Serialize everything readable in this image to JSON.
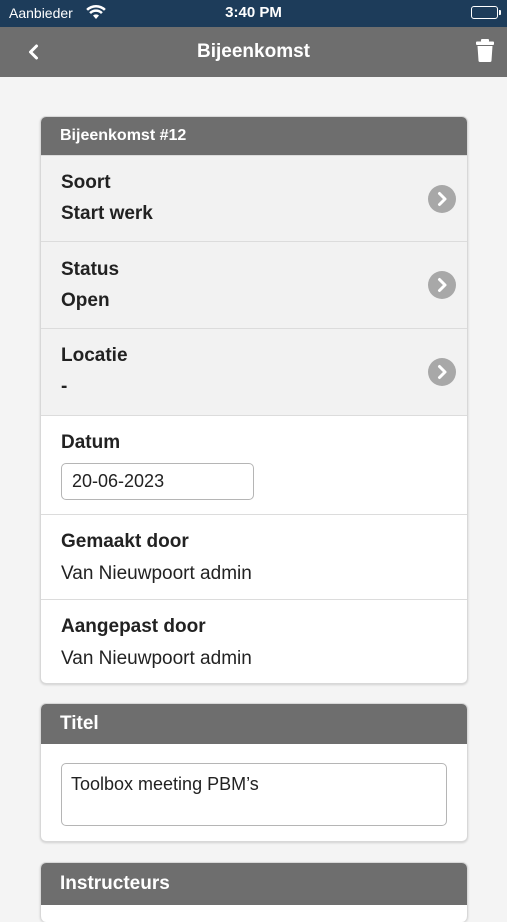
{
  "status_bar": {
    "carrier": "Aanbieder",
    "time": "3:40 PM"
  },
  "nav": {
    "title": "Bijeenkomst",
    "back_icon": "chevron-left-icon",
    "delete_icon": "trash-icon"
  },
  "meeting_card": {
    "header": "Bijeenkomst #12",
    "soort": {
      "label": "Soort",
      "value": "Start werk"
    },
    "status": {
      "label": "Status",
      "value": "Open"
    },
    "locatie": {
      "label": "Locatie",
      "value": "-"
    },
    "datum": {
      "label": "Datum",
      "value": "20-06-2023"
    },
    "gemaakt_door": {
      "label": "Gemaakt door",
      "value": "Van Nieuwpoort admin"
    },
    "aangepast_door": {
      "label": "Aangepast door",
      "value": "Van Nieuwpoort admin"
    }
  },
  "title_card": {
    "header": "Titel",
    "value": "Toolbox meeting PBM’s"
  },
  "instructeurs_card": {
    "header": "Instructeurs"
  },
  "colors": {
    "status_bar": "#1d3c5a",
    "nav_bar": "#6e6e6e",
    "card_header": "#6e6e6e",
    "chevron": "#a8a8a8"
  }
}
